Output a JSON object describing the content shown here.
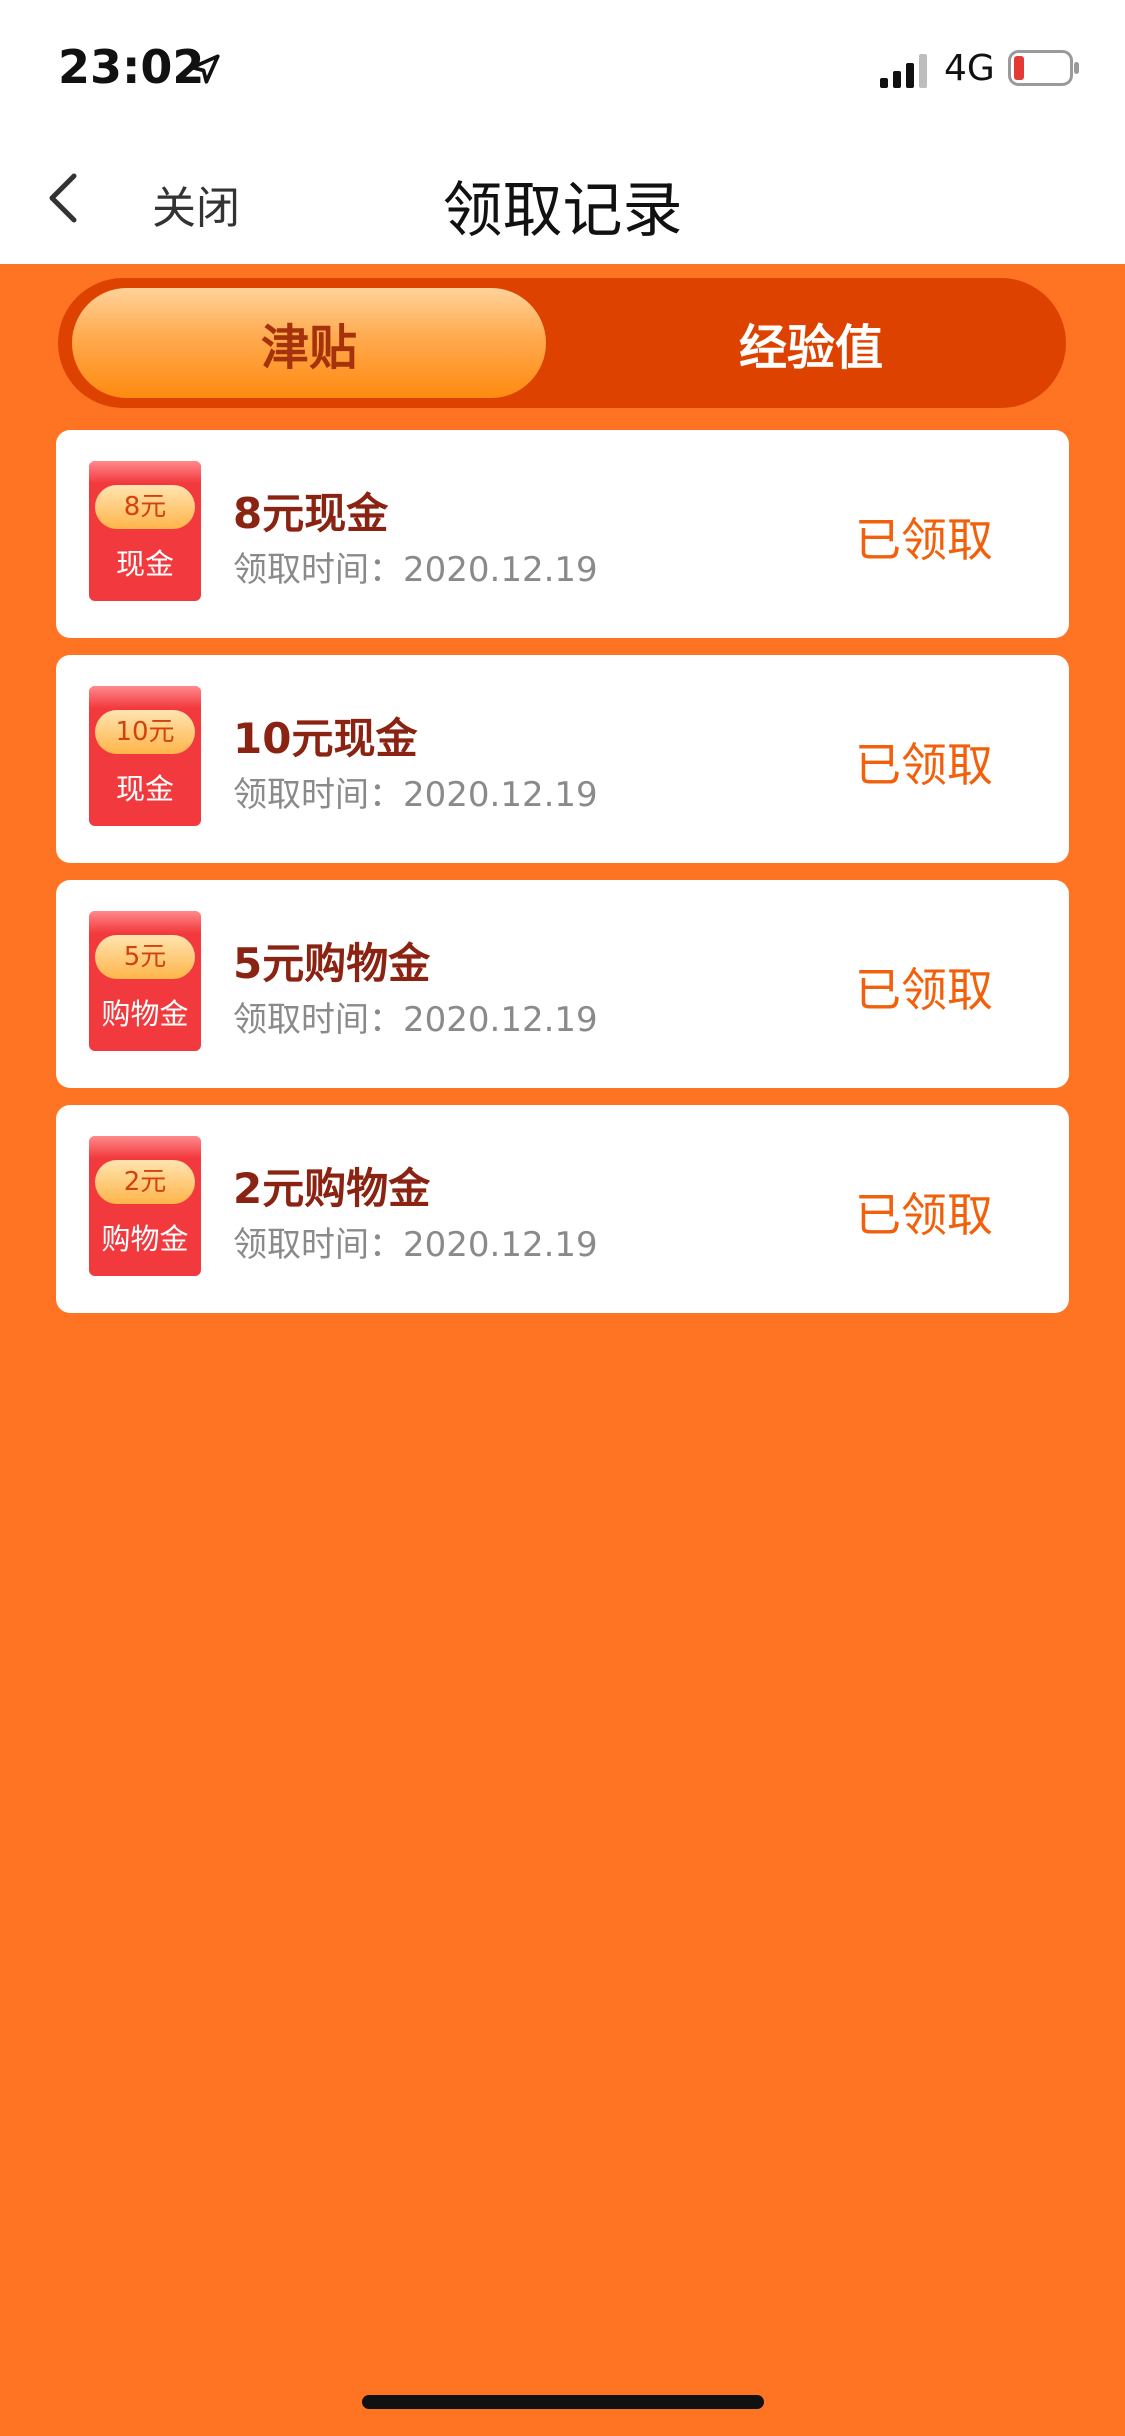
{
  "status_bar": {
    "time": "23:02",
    "network": "4G",
    "icons": [
      "location-arrow-icon",
      "signal-icon",
      "battery-icon"
    ]
  },
  "nav": {
    "close_label": "关闭",
    "title": "领取记录",
    "back_icon": "chevron-left-icon"
  },
  "tabs": [
    {
      "label": "津贴",
      "active": true
    },
    {
      "label": "经验值",
      "active": false
    }
  ],
  "records": [
    {
      "amount": "8元",
      "badge_label": "现金",
      "title": "8元现金",
      "time_label": "领取时间：",
      "date": "2020.12.19",
      "status": "已领取"
    },
    {
      "amount": "10元",
      "badge_label": "现金",
      "title": "10元现金",
      "time_label": "领取时间：",
      "date": "2020.12.19",
      "status": "已领取"
    },
    {
      "amount": "5元",
      "badge_label": "购物金",
      "title": "5元购物金",
      "time_label": "领取时间：",
      "date": "2020.12.19",
      "status": "已领取"
    },
    {
      "amount": "2元",
      "badge_label": "购物金",
      "title": "2元购物金",
      "time_label": "领取时间：",
      "date": "2020.12.19",
      "status": "已领取"
    }
  ],
  "colors": {
    "background": "#FF7423",
    "tab_track": "#DD4200",
    "title_text": "#8A2312",
    "status_text": "#F2600B",
    "badge_red": "#F23A3E"
  }
}
